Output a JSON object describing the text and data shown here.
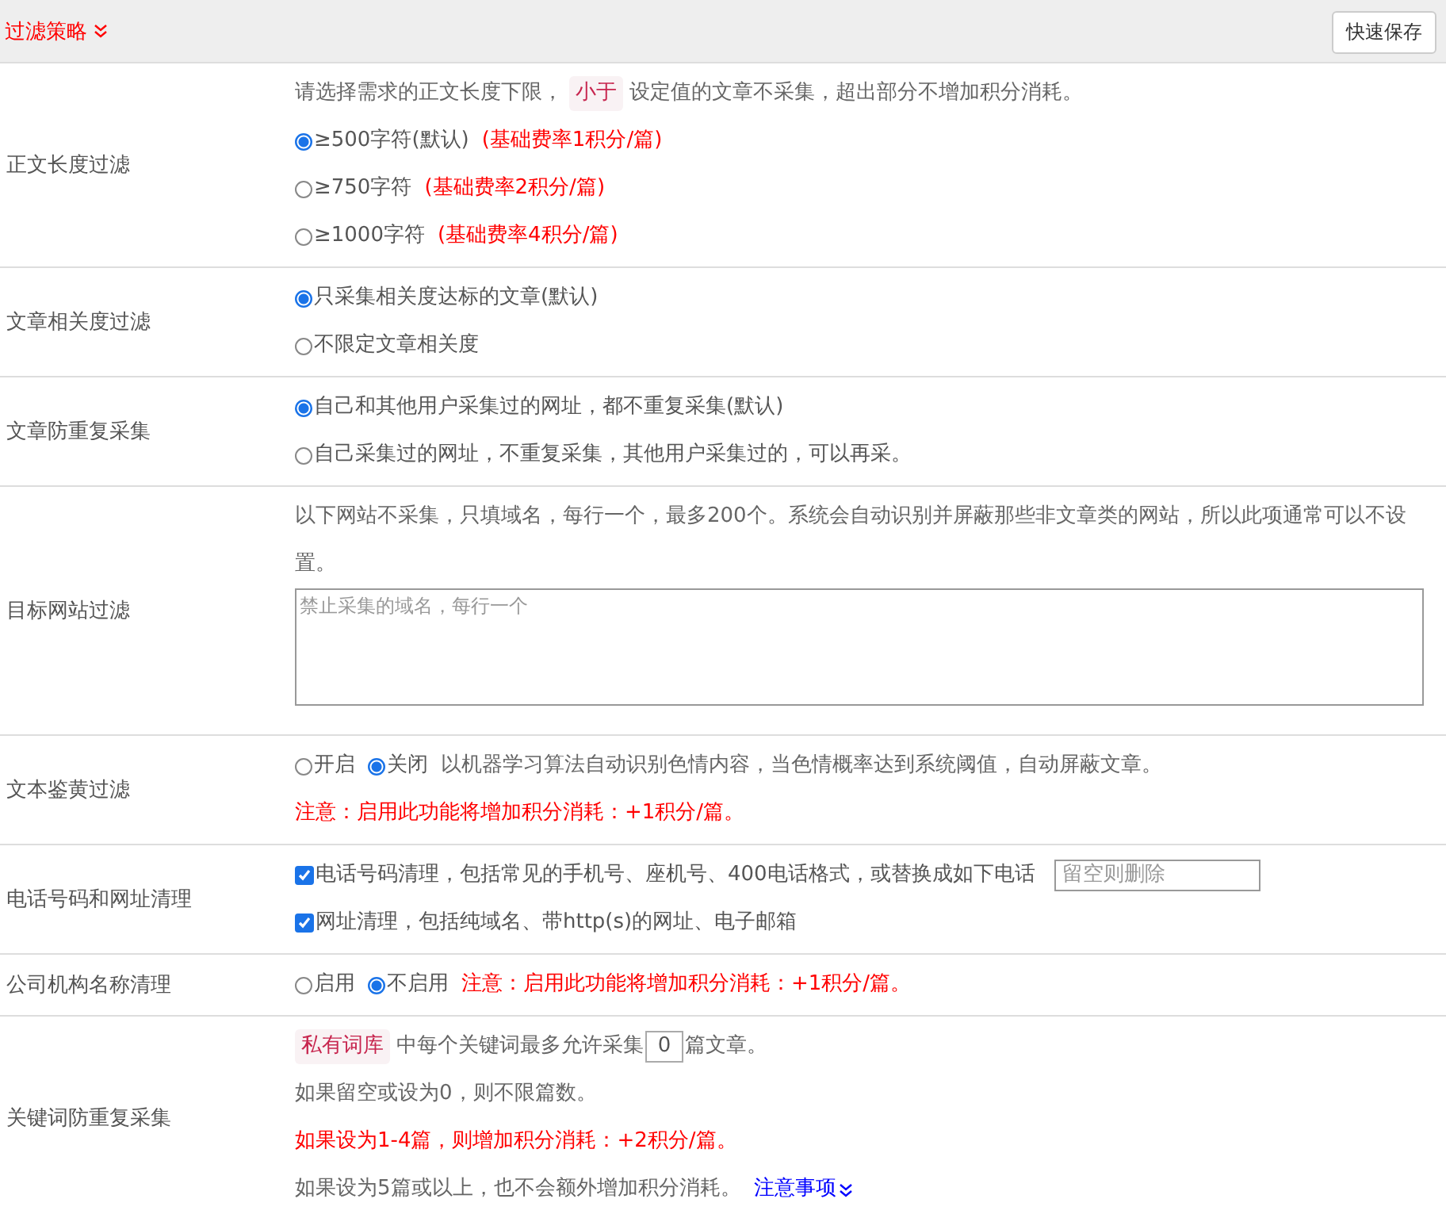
{
  "header": {
    "title": "过滤策略",
    "save_button": "快速保存"
  },
  "rows": [
    {
      "label": "正文长度过滤",
      "lines": [
        {
          "items": [
            {
              "kind": "text",
              "text": "请选择需求的正文长度下限，"
            },
            {
              "kind": "tag",
              "text": "小于"
            },
            {
              "kind": "text",
              "text": "设定值的文章不采集，超出部分不增加积分消耗。"
            }
          ]
        },
        {
          "items": [
            {
              "kind": "radio",
              "text": "≥500字符(默认)",
              "selected": true
            },
            {
              "kind": "note",
              "text": "(基础费率1积分/篇)"
            }
          ]
        },
        {
          "items": [
            {
              "kind": "radio",
              "text": "≥750字符",
              "selected": false
            },
            {
              "kind": "note",
              "text": "(基础费率2积分/篇)"
            }
          ]
        },
        {
          "items": [
            {
              "kind": "radio",
              "text": "≥1000字符",
              "selected": false
            },
            {
              "kind": "note",
              "text": "(基础费率4积分/篇)"
            }
          ]
        }
      ]
    },
    {
      "label": "文章相关度过滤",
      "lines": [
        {
          "items": [
            {
              "kind": "radio",
              "text": "只采集相关度达标的文章(默认)",
              "selected": true
            }
          ]
        },
        {
          "items": [
            {
              "kind": "radio",
              "text": "不限定文章相关度",
              "selected": false
            }
          ]
        }
      ]
    },
    {
      "label": "文章防重复采集",
      "lines": [
        {
          "items": [
            {
              "kind": "radio",
              "text": "自己和其他用户采集过的网址，都不重复采集(默认)",
              "selected": true
            }
          ]
        },
        {
          "items": [
            {
              "kind": "radio",
              "text": "自己采集过的网址，不重复采集，其他用户采集过的，可以再采。",
              "selected": false
            }
          ]
        }
      ]
    },
    {
      "label": "目标网站过滤",
      "lines": [
        {
          "items": [
            {
              "kind": "text",
              "text": "以下网站不采集，只填域名，每行一个，最多200个。系统会自动识别并屏蔽那些非文章类的网站，所以此项通常可以不设置。"
            }
          ]
        },
        {
          "items": [
            {
              "kind": "textarea",
              "placeholder": "禁止采集的域名，每行一个"
            }
          ]
        }
      ]
    },
    {
      "label": "文本鉴黄过滤",
      "lines": [
        {
          "items": [
            {
              "kind": "radio",
              "text": "开启",
              "selected": false
            },
            {
              "kind": "radio",
              "text": "关闭",
              "selected": true
            },
            {
              "kind": "text",
              "text": "以机器学习算法自动识别色情内容，当色情概率达到系统阈值，自动屏蔽文章。"
            }
          ]
        },
        {
          "items": [
            {
              "kind": "note",
              "text": "注意：启用此功能将增加积分消耗：+1积分/篇。"
            }
          ]
        }
      ]
    },
    {
      "label": "电话号码和网址清理",
      "lines": [
        {
          "items": [
            {
              "kind": "checkbox",
              "text": "电话号码清理，包括常见的手机号、座机号、400电话格式，或替换成如下电话",
              "checked": true
            },
            {
              "kind": "field",
              "placeholder": "留空则删除"
            }
          ]
        },
        {
          "items": [
            {
              "kind": "checkbox",
              "text": "网址清理，包括纯域名、带http(s)的网址、电子邮箱",
              "checked": true
            }
          ]
        }
      ]
    },
    {
      "label": "公司机构名称清理",
      "lines": [
        {
          "items": [
            {
              "kind": "radio",
              "text": "启用",
              "selected": false
            },
            {
              "kind": "radio",
              "text": "不启用",
              "selected": true
            },
            {
              "kind": "note",
              "text": "注意：启用此功能将增加积分消耗：+1积分/篇。"
            }
          ]
        }
      ]
    },
    {
      "label": "关键词防重复采集",
      "lines": [
        {
          "items": [
            {
              "kind": "tag",
              "text": "私有词库"
            },
            {
              "kind": "text",
              "text": "中每个关键词最多允许采集"
            },
            {
              "kind": "input",
              "value": "0"
            },
            {
              "kind": "text",
              "text": "篇文章。"
            }
          ]
        },
        {
          "items": [
            {
              "kind": "text",
              "text": "如果留空或设为0，则不限篇数。"
            }
          ]
        },
        {
          "items": [
            {
              "kind": "note",
              "text": "如果设为1-4篇，则增加积分消耗：+2积分/篇。"
            }
          ]
        },
        {
          "items": [
            {
              "kind": "text",
              "text": "如果设为5篇或以上，也不会额外增加积分消耗。"
            },
            {
              "kind": "link",
              "text": "注意事项"
            }
          ]
        }
      ]
    }
  ]
}
